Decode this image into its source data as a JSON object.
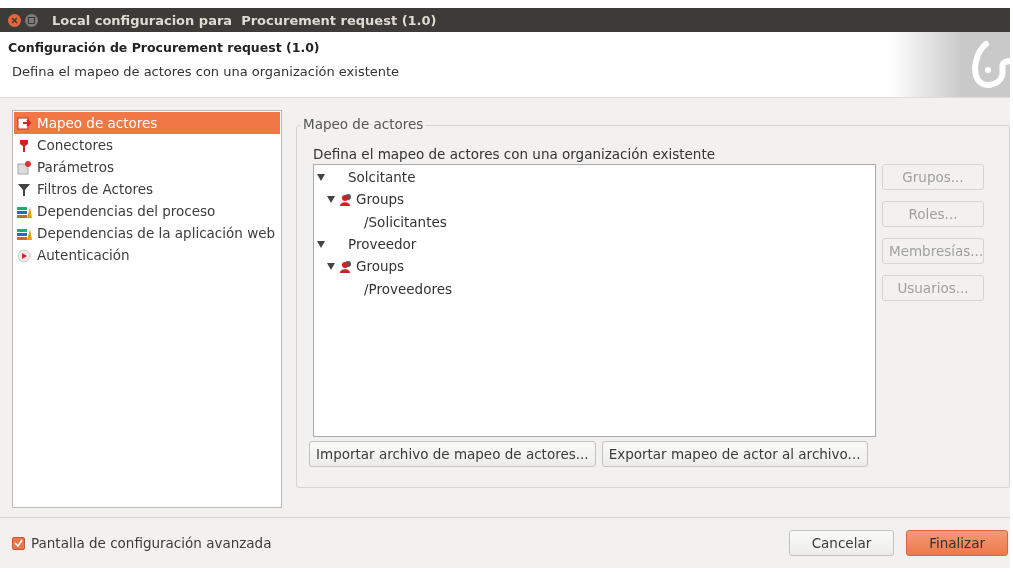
{
  "window": {
    "title": "Local configuracion para  Procurement request (1.0)"
  },
  "header": {
    "title": "Configuración de Procurement request (1.0)",
    "description": "Defina el mapeo de actores con una organización existente"
  },
  "sidebar": {
    "items": [
      {
        "label": "Mapeo de actores",
        "kind": "mapping",
        "selected": true
      },
      {
        "label": "Conectores",
        "kind": "connector",
        "selected": false
      },
      {
        "label": "Parámetros",
        "kind": "parameter",
        "selected": false
      },
      {
        "label": "Filtros de Actores",
        "kind": "filter",
        "selected": false
      },
      {
        "label": "Dependencias del proceso",
        "kind": "books",
        "selected": false
      },
      {
        "label": "Dependencias de la aplicación web",
        "kind": "books",
        "selected": false
      },
      {
        "label": "Autenticación",
        "kind": "auth",
        "selected": false
      }
    ]
  },
  "group": {
    "title": "Mapeo de actores",
    "description": "Defina el mapeo de actores con una organización existente",
    "tree": [
      {
        "label": "Solcitante",
        "kind": "actor",
        "expanded": true,
        "children": [
          {
            "label": "Groups",
            "kind": "groups",
            "expanded": true,
            "children": [
              {
                "label": "/Solicitantes",
                "kind": "entry"
              }
            ]
          }
        ]
      },
      {
        "label": "Proveedor",
        "kind": "actor",
        "expanded": true,
        "children": [
          {
            "label": "Groups",
            "kind": "groups",
            "expanded": true,
            "children": [
              {
                "label": "/Proveedores",
                "kind": "entry"
              }
            ]
          }
        ]
      }
    ],
    "side_buttons": [
      {
        "label": "Grupos...",
        "disabled": true
      },
      {
        "label": "Roles...",
        "disabled": true
      },
      {
        "label": "Membresías...",
        "disabled": true
      },
      {
        "label": "Usuarios...",
        "disabled": true
      }
    ],
    "bottom_buttons": [
      {
        "label": "Importar archivo de mapeo de actores...",
        "disabled": false
      },
      {
        "label": "Exportar mapeo de actor al archivo...",
        "disabled": false
      }
    ]
  },
  "footer": {
    "checkbox": {
      "label": "Pantalla de configuración avanzada",
      "checked": true
    },
    "buttons": [
      {
        "label": "Cancelar",
        "kind": "secondary"
      },
      {
        "label": "Finalizar",
        "kind": "primary"
      }
    ]
  }
}
